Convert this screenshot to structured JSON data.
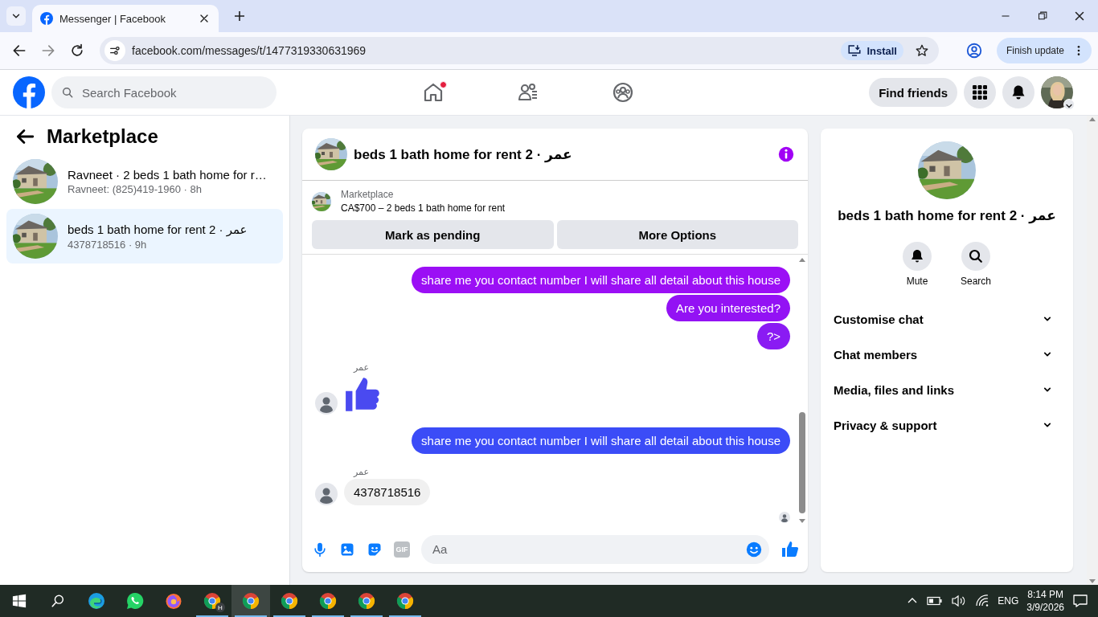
{
  "browser": {
    "tab": {
      "title": "Messenger | Facebook",
      "selected": true
    },
    "url": "facebook.com/messages/t/1477319330631969",
    "install_label": "Install",
    "update_label": "Finish update"
  },
  "header": {
    "search": {
      "placeholder": "Search Facebook"
    },
    "nav": [
      {
        "kind": "home",
        "notify": true
      },
      {
        "kind": "friends",
        "notify": false
      },
      {
        "kind": "groups",
        "notify": false
      }
    ],
    "find_friends": "Find friends"
  },
  "sidebar": {
    "title": "Marketplace",
    "threads": [
      {
        "title": "Ravneet · 2 beds 1 bath home for r…",
        "preview": "Ravneet: (825)419-1960 · 8h",
        "selected": false
      },
      {
        "title": "عمر · 2 beds 1 bath home for rent",
        "preview": "4378718516 · 9h",
        "selected": true
      }
    ]
  },
  "chat": {
    "title": "عمر · 2 beds 1 bath home for rent",
    "listing": {
      "label": "Marketplace",
      "text": "CA$700 – 2 beds 1 bath home for rent"
    },
    "actions": [
      "Mark as pending",
      "More Options"
    ],
    "messages": [
      {
        "kind": "sent",
        "text": "share me you contact number I will share all detail about this house",
        "color": "#9b0ff5"
      },
      {
        "kind": "sent",
        "text": "Are you interested?",
        "color": "#9312f4"
      },
      {
        "kind": "sent",
        "text": "?>",
        "color": "#8a1bf3"
      },
      {
        "kind": "like",
        "sender": "عمر"
      },
      {
        "kind": "sent",
        "text": "share me you contact number I will share all detail about this house",
        "color": "#3b4cf7"
      },
      {
        "kind": "received",
        "sender": "عمر",
        "text": "4378718516"
      }
    ],
    "composer": {
      "placeholder": "Aa",
      "gif_label": "GIF"
    }
  },
  "details": {
    "title": "عمر · 2 beds 1 bath home for rent",
    "actions": [
      {
        "kind": "mute",
        "label": "Mute"
      },
      {
        "kind": "search",
        "label": "Search"
      }
    ],
    "sections": [
      {
        "label": "Customise chat",
        "expanded": false
      },
      {
        "label": "Chat members",
        "expanded": false
      },
      {
        "label": "Media, files and links",
        "expanded": false
      },
      {
        "label": "Privacy & support",
        "expanded": false
      }
    ]
  },
  "taskbar": {
    "apps": [
      {
        "kind": "edge",
        "active": false
      },
      {
        "kind": "whatsapp",
        "active": false
      },
      {
        "kind": "firefox",
        "active": false
      },
      {
        "kind": "chrome",
        "badge": "H",
        "active": false
      },
      {
        "kind": "chrome",
        "active": true
      },
      {
        "kind": "chrome",
        "active": false
      },
      {
        "kind": "chrome",
        "active": false
      },
      {
        "kind": "chrome",
        "active": false
      },
      {
        "kind": "chrome",
        "active": false
      }
    ],
    "language": "ENG",
    "time": "8:14 PM",
    "date": "3/9/2026"
  }
}
